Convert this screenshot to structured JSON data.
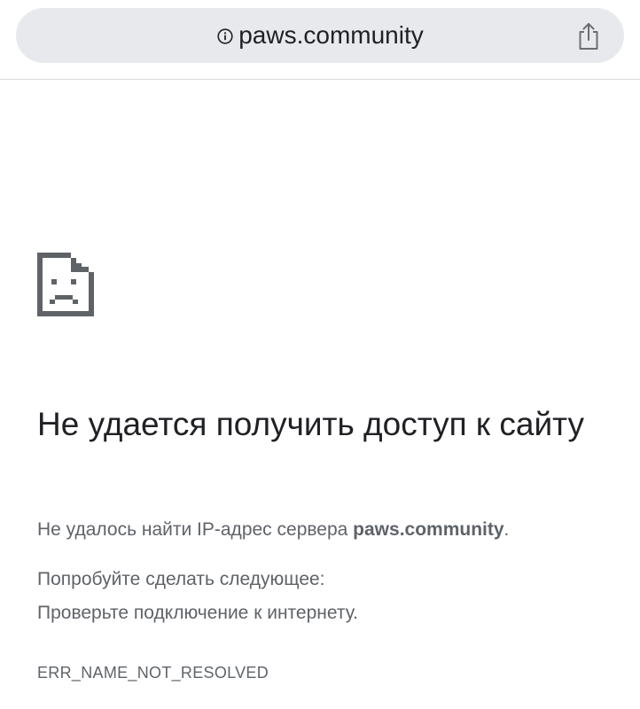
{
  "address_bar": {
    "url": "paws.community",
    "info_icon": "info-circle-icon",
    "share_icon": "share-icon"
  },
  "error_page": {
    "icon": "sad-document-icon",
    "title": "Не удается получить доступ к сайту",
    "description_prefix": "Не удалось найти IP-адрес сервера ",
    "description_host": "paws.community",
    "description_suffix": ".",
    "suggestions_title": "Попробуйте сделать следующее:",
    "suggestions": [
      "Проверьте подключение к интернету."
    ],
    "error_code": "ERR_NAME_NOT_RESOLVED"
  },
  "colors": {
    "pill_background": "#e8e9ec",
    "title_text": "#202124",
    "secondary_text": "#5f6368"
  }
}
